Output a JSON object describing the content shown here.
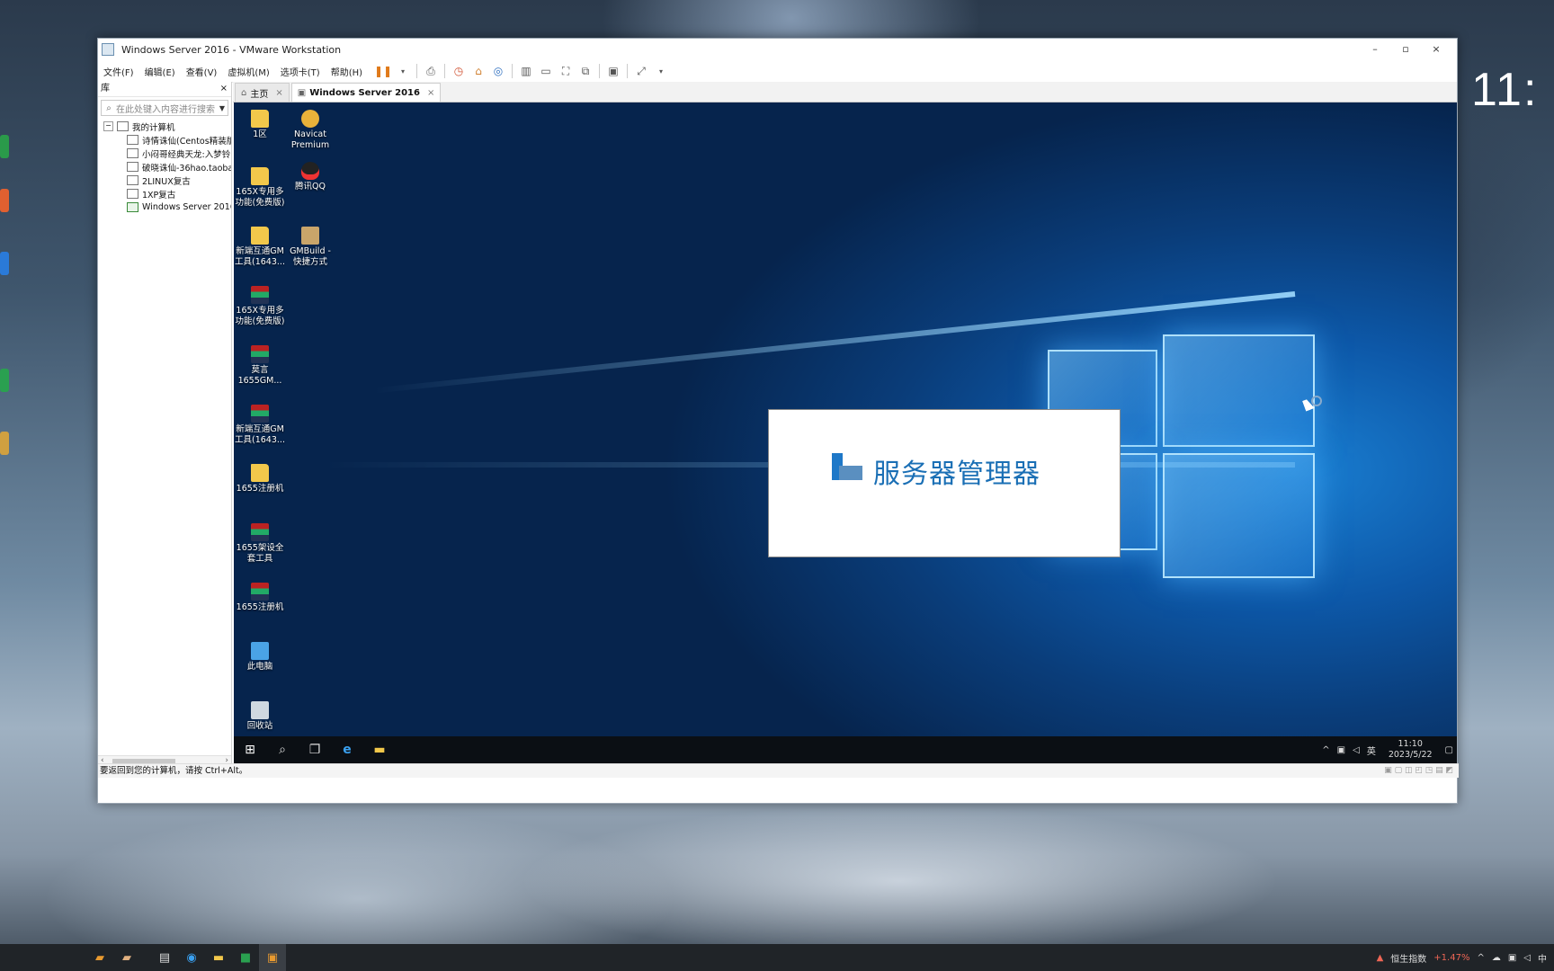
{
  "host": {
    "clock_partial": "11:"
  },
  "window": {
    "title": "Windows Server 2016 - VMware Workstation",
    "minimize": "–",
    "maximize": "▫",
    "close": "×"
  },
  "menu": [
    "文件(F)",
    "编辑(E)",
    "查看(V)",
    "虚拟机(M)",
    "选项卡(T)",
    "帮助(H)"
  ],
  "library": {
    "title": "库",
    "close": "×",
    "search_placeholder": "在此处键入内容进行搜索",
    "root": "我的计算机",
    "items": [
      "诗情诛仙(Centos精装版",
      "小闷哥经典天龙:入梦铃",
      "破晓诛仙-36hao.taoba",
      "2LINUX复古",
      "1XP复古",
      "Windows Server 2016"
    ]
  },
  "tabs": [
    {
      "label": "主页",
      "icon": "home-icon"
    },
    {
      "label": "Windows Server 2016",
      "icon": "vm-icon"
    }
  ],
  "desktop_icons": [
    {
      "label": "1区",
      "type": "folder"
    },
    {
      "label": "Navicat Premium",
      "type": "navicat"
    },
    {
      "label": "165X专用多功能(免费版)",
      "type": "folder"
    },
    {
      "label": "腾讯QQ",
      "type": "qq"
    },
    {
      "label": "新端互通GM工具(1643...",
      "type": "folder"
    },
    {
      "label": "GMBuild - 快捷方式",
      "type": "gm"
    },
    {
      "label": "165X专用多功能(免费版)",
      "type": "rar"
    },
    {
      "label": "莫言 1655GM...",
      "type": "rar"
    },
    {
      "label": "新端互通GM工具(1643...",
      "type": "rar"
    },
    {
      "label": "1655注册机",
      "type": "folder"
    },
    {
      "label": "1655架设全套工具",
      "type": "rar"
    },
    {
      "label": "1655注册机",
      "type": "rar"
    },
    {
      "label": "此电脑",
      "type": "pc"
    },
    {
      "label": "回收站",
      "type": "bin"
    }
  ],
  "splash": {
    "text": "服务器管理器"
  },
  "guest_taskbar": {
    "ime": "英",
    "time": "11:10",
    "date": "2023/5/22"
  },
  "statusbar": {
    "message": "要返回到您的计算机，请按 Ctrl+Alt。"
  },
  "host_taskbar": {
    "stock_name": "恒生指数",
    "stock_change": "+1.47%",
    "ime": "中"
  }
}
